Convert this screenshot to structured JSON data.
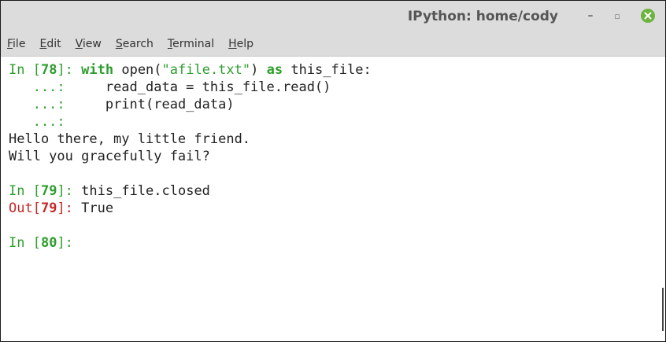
{
  "window": {
    "title": "IPython: home/cody",
    "minimize_glyph": "–",
    "maximize_glyph": "▫",
    "close_icon": "close-icon",
    "close_color": "#6db33f"
  },
  "menu": {
    "items": [
      {
        "first": "F",
        "rest": "ile"
      },
      {
        "first": "E",
        "rest": "dit"
      },
      {
        "first": "V",
        "rest": "iew"
      },
      {
        "first": "S",
        "rest": "earch"
      },
      {
        "first": "T",
        "rest": "erminal"
      },
      {
        "first": "H",
        "rest": "elp"
      }
    ]
  },
  "terminal": {
    "cell78": {
      "prompt_in": "In [",
      "num": "78",
      "prompt_close": "]: ",
      "kw_with": "with",
      "code1a": " open(",
      "str": "\"afile.txt\"",
      "code1b": ") ",
      "kw_as": "as",
      "code1c": " this_file:",
      "cont": "   ...:",
      "code2": "     read_data = this_file.read()",
      "code3": "     print(read_data)"
    },
    "output": [
      "Hello there, my little friend.",
      "Will you gracefully fail?"
    ],
    "cell79": {
      "prompt_in": "In [",
      "num": "79",
      "prompt_close": "]: ",
      "code": "this_file.closed",
      "out_prompt": "Out[",
      "out_num": "79",
      "out_close": "]: ",
      "out_value": "True"
    },
    "cell80": {
      "prompt_in": "In [",
      "num": "80",
      "prompt_close": "]:"
    }
  },
  "colors": {
    "prompt_green": "#2e9e2e",
    "out_red": "#c62828",
    "titlebar": "#dcdcdc"
  }
}
